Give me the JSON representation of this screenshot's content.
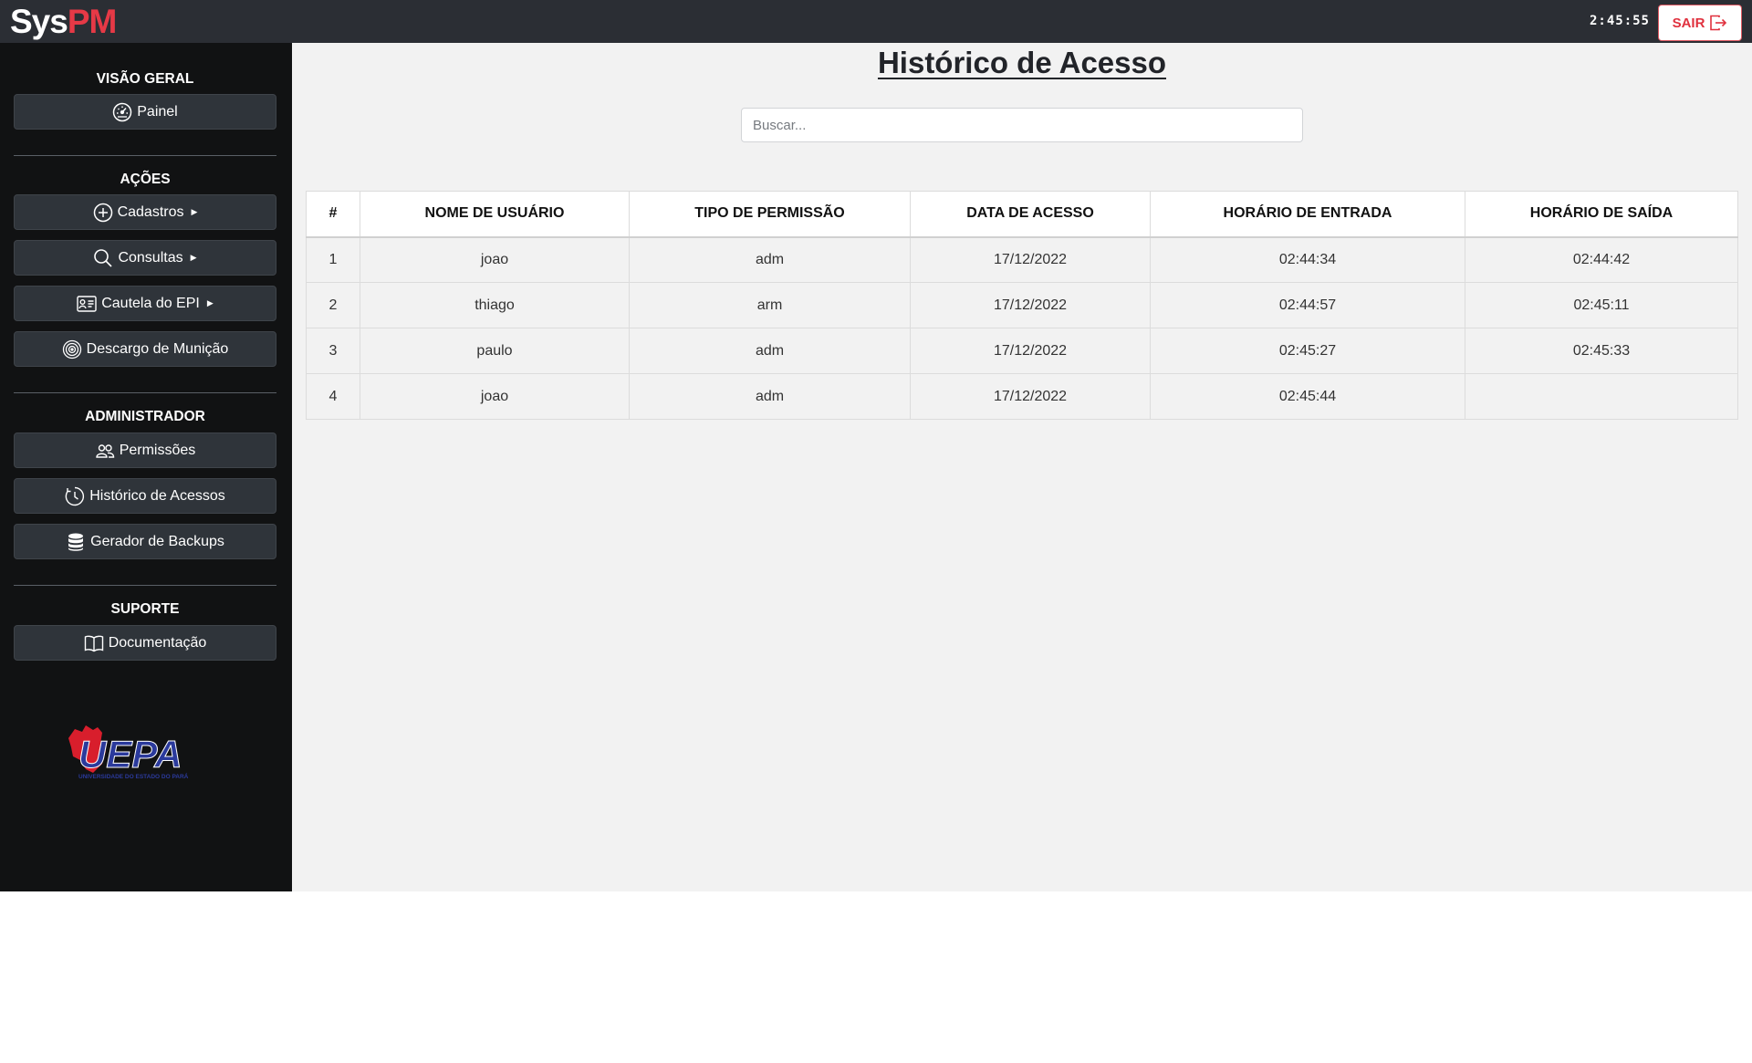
{
  "brand": {
    "part1": "Sys",
    "part2": "PM"
  },
  "header": {
    "clock": "2:45:55",
    "logout_label": "SAIR"
  },
  "sidebar": {
    "sections": [
      {
        "title": "VISÃO GERAL"
      },
      {
        "title": "AÇÕES"
      },
      {
        "title": "ADMINISTRADOR"
      },
      {
        "title": "SUPORTE"
      }
    ],
    "items": [
      {
        "label": "Painel",
        "icon": "speedometer-icon"
      },
      {
        "label": "Cadastros",
        "icon": "plus-circle-icon",
        "caret": "▶"
      },
      {
        "label": "Consultas",
        "icon": "search-icon",
        "caret": "▶"
      },
      {
        "label": "Cautela do EPI",
        "icon": "person-vcard-icon",
        "caret": "▶"
      },
      {
        "label": "Descargo de Munição",
        "icon": "target-icon"
      },
      {
        "label": "Permissões",
        "icon": "people-icon"
      },
      {
        "label": "Histórico de Acessos",
        "icon": "clock-history-icon"
      },
      {
        "label": "Gerador de Backups",
        "icon": "database-icon"
      },
      {
        "label": "Documentação",
        "icon": "book-icon"
      }
    ],
    "logo": {
      "text": "UEPA",
      "subtitle": "UNIVERSIDADE DO ESTADO DO PARÁ"
    }
  },
  "main": {
    "title": "Histórico de Acesso",
    "search_placeholder": "Buscar...",
    "table": {
      "columns": [
        "#",
        "NOME DE USUÁRIO",
        "TIPO DE PERMISSÃO",
        "DATA DE ACESSO",
        "HORÁRIO DE ENTRADA",
        "HORÁRIO DE SAÍDA"
      ],
      "rows": [
        [
          "1",
          "joao",
          "adm",
          "17/12/2022",
          "02:44:34",
          "02:44:42"
        ],
        [
          "2",
          "thiago",
          "arm",
          "17/12/2022",
          "02:44:57",
          "02:45:11"
        ],
        [
          "3",
          "paulo",
          "adm",
          "17/12/2022",
          "02:45:27",
          "02:45:33"
        ],
        [
          "4",
          "joao",
          "adm",
          "17/12/2022",
          "02:45:44",
          ""
        ]
      ]
    }
  },
  "colors": {
    "topbar": "#2b2e34",
    "sidebar": "#111213",
    "accent": "#e63946",
    "button": "#2f343a",
    "main_bg": "#f2f2f2"
  }
}
